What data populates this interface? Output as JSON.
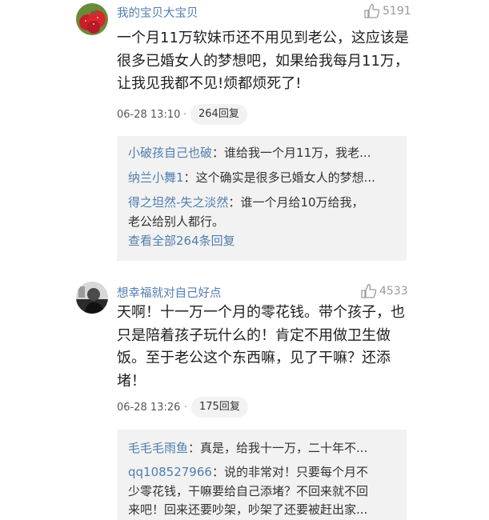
{
  "comments": [
    {
      "user": "我的宝贝大宝贝",
      "likes": "5191",
      "avatar_icon": "strawberry-avatar",
      "content": "一个月11万软妹币还不用见到老公，这应该是很多已婚女人的梦想吧，如果给我每月11万，让我见我都不见!烦都烦死了!",
      "time": "06-28 13:10",
      "dot": "·",
      "reply_count": "264回复",
      "replies": [
        {
          "name": "小破孩自己也破",
          "sep": "：",
          "text": "谁给我一个月11万，我老..."
        },
        {
          "name": "纳兰小舞1",
          "sep": "：",
          "text": "这个确实是很多已婚女人的梦想..."
        },
        {
          "name": "得之坦然-失之淡然",
          "sep": "：",
          "text": "谁一个月给10万给我，"
        },
        {
          "name": "",
          "sep": "",
          "text": "老公给别人都行。"
        }
      ],
      "view_all": "查看全部264条回复"
    },
    {
      "user": "想幸福就对自己好点",
      "likes": "4533",
      "avatar_icon": "grayscale-photo-avatar",
      "content": "天啊！十一万一个月的零花钱。带个孩子，也只是陪着孩子玩什么的！肯定不用做卫生做饭。至于老公这个东西嘛，见了干嘛？还添堵！",
      "time": "06-28 13:26",
      "dot": "·",
      "reply_count": "175回复",
      "replies": [
        {
          "name": "毛毛毛雨鱼",
          "sep": "：",
          "text": "真是，给我十一万，二十年不..."
        },
        {
          "name": "qq108527966",
          "sep": "：",
          "text": "说的非常对！只要每个月不"
        },
        {
          "name": "",
          "sep": "",
          "text": "少零花钱，干嘛要给自己添堵？不回来就不回"
        },
        {
          "name": "",
          "sep": "",
          "text": "来吧！回来还要吵架，吵架了还要被赶出家..."
        }
      ]
    }
  ],
  "colors": {
    "link": "#507daf",
    "reply_bg": "#f2f2f2",
    "muted": "#9a9a9a"
  }
}
